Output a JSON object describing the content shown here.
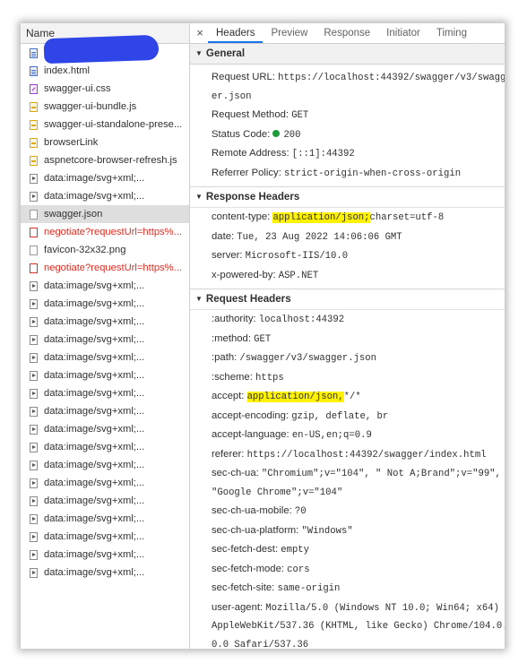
{
  "network": {
    "header": "Name",
    "requests": [
      {
        "name": "",
        "icon": "document-icon",
        "state": "normal"
      },
      {
        "name": "index.html",
        "icon": "document-icon",
        "state": "normal"
      },
      {
        "name": "swagger-ui.css",
        "icon": "stylesheet-icon",
        "state": "normal"
      },
      {
        "name": "swagger-ui-bundle.js",
        "icon": "script-icon",
        "state": "normal"
      },
      {
        "name": "swagger-ui-standalone-prese...",
        "icon": "script-icon",
        "state": "normal"
      },
      {
        "name": "browserLink",
        "icon": "script-icon",
        "state": "normal"
      },
      {
        "name": "aspnetcore-browser-refresh.js",
        "icon": "script-icon",
        "state": "normal"
      },
      {
        "name": "data:image/svg+xml;...",
        "icon": "image-icon",
        "state": "normal"
      },
      {
        "name": "data:image/svg+xml;...",
        "icon": "image-icon",
        "state": "normal"
      },
      {
        "name": "swagger.json",
        "icon": "file-icon",
        "state": "selected"
      },
      {
        "name": "negotiate?requestUrl=https%...",
        "icon": "file-icon",
        "state": "error"
      },
      {
        "name": "favicon-32x32.png",
        "icon": "file-icon",
        "state": "normal"
      },
      {
        "name": "negotiate?requestUrl=https%...",
        "icon": "file-icon",
        "state": "error"
      },
      {
        "name": "data:image/svg+xml;...",
        "icon": "image-icon",
        "state": "normal"
      },
      {
        "name": "data:image/svg+xml;...",
        "icon": "image-icon",
        "state": "normal"
      },
      {
        "name": "data:image/svg+xml;...",
        "icon": "image-icon",
        "state": "normal"
      },
      {
        "name": "data:image/svg+xml;...",
        "icon": "image-icon",
        "state": "normal"
      },
      {
        "name": "data:image/svg+xml;...",
        "icon": "image-icon",
        "state": "normal"
      },
      {
        "name": "data:image/svg+xml;...",
        "icon": "image-icon",
        "state": "normal"
      },
      {
        "name": "data:image/svg+xml;...",
        "icon": "image-icon",
        "state": "normal"
      },
      {
        "name": "data:image/svg+xml;...",
        "icon": "image-icon",
        "state": "normal"
      },
      {
        "name": "data:image/svg+xml;...",
        "icon": "image-icon",
        "state": "normal"
      },
      {
        "name": "data:image/svg+xml;...",
        "icon": "image-icon",
        "state": "normal"
      },
      {
        "name": "data:image/svg+xml;...",
        "icon": "image-icon",
        "state": "normal"
      },
      {
        "name": "data:image/svg+xml;...",
        "icon": "image-icon",
        "state": "normal"
      },
      {
        "name": "data:image/svg+xml;...",
        "icon": "image-icon",
        "state": "normal"
      },
      {
        "name": "data:image/svg+xml;...",
        "icon": "image-icon",
        "state": "normal"
      },
      {
        "name": "data:image/svg+xml;...",
        "icon": "image-icon",
        "state": "normal"
      },
      {
        "name": "data:image/svg+xml;...",
        "icon": "image-icon",
        "state": "normal"
      },
      {
        "name": "data:image/svg+xml;...",
        "icon": "image-icon",
        "state": "normal"
      }
    ]
  },
  "details": {
    "close_glyph": "×",
    "tabs": [
      "Headers",
      "Preview",
      "Response",
      "Initiator",
      "Timing"
    ],
    "active_tab": "Headers",
    "general": {
      "title": "General",
      "request_url_key": "Request URL:",
      "request_url_line1": "https://localhost:44392/swagger/v3/swagg",
      "request_url_line2": "er.json",
      "method_key": "Request Method:",
      "method_val": "GET",
      "status_key": "Status Code:",
      "status_val": "200",
      "status_color": "#1e9c3a",
      "remote_key": "Remote Address:",
      "remote_val": "[::1]:44392",
      "referrer_key": "Referrer Policy:",
      "referrer_val": "strict-origin-when-cross-origin"
    },
    "response_headers": {
      "title": "Response Headers",
      "content_type_key": "content-type:",
      "content_type_hl": "application/json;",
      "content_type_rest": "charset=utf-8",
      "date_key": "date:",
      "date_val": "Tue, 23 Aug 2022 14:06:06 GMT",
      "server_key": "server:",
      "server_val": "Microsoft-IIS/10.0",
      "powered_key": "x-powered-by:",
      "powered_val": "ASP.NET"
    },
    "request_headers": {
      "title": "Request Headers",
      "authority_key": ":authority:",
      "authority_val": "localhost:44392",
      "method_key": ":method:",
      "method_val": "GET",
      "path_key": ":path:",
      "path_val": "/swagger/v3/swagger.json",
      "scheme_key": ":scheme:",
      "scheme_val": "https",
      "accept_key": "accept:",
      "accept_hl": "application/json,",
      "accept_rest": "*/*",
      "accept_encoding_key": "accept-encoding:",
      "accept_encoding_val": "gzip, deflate, br",
      "accept_language_key": "accept-language:",
      "accept_language_val": "en-US,en;q=0.9",
      "referer_key": "referer:",
      "referer_val": "https://localhost:44392/swagger/index.html",
      "sec_ch_ua_key": "sec-ch-ua:",
      "sec_ch_ua_line1": "\"Chromium\";v=\"104\", \" Not A;Brand\";v=\"99\",",
      "sec_ch_ua_line2": "\"Google Chrome\";v=\"104\"",
      "mobile_key": "sec-ch-ua-mobile:",
      "mobile_val": "?0",
      "platform_key": "sec-ch-ua-platform:",
      "platform_val": "\"Windows\"",
      "dest_key": "sec-fetch-dest:",
      "dest_val": "empty",
      "mode_key": "sec-fetch-mode:",
      "mode_val": "cors",
      "site_key": "sec-fetch-site:",
      "site_val": "same-origin",
      "ua_key": "user-agent:",
      "ua_line1": "Mozilla/5.0 (Windows NT 10.0; Win64; x64)",
      "ua_line2": "AppleWebKit/537.36 (KHTML, like Gecko) Chrome/104.0.",
      "ua_line3": "0.0 Safari/537.36"
    }
  }
}
